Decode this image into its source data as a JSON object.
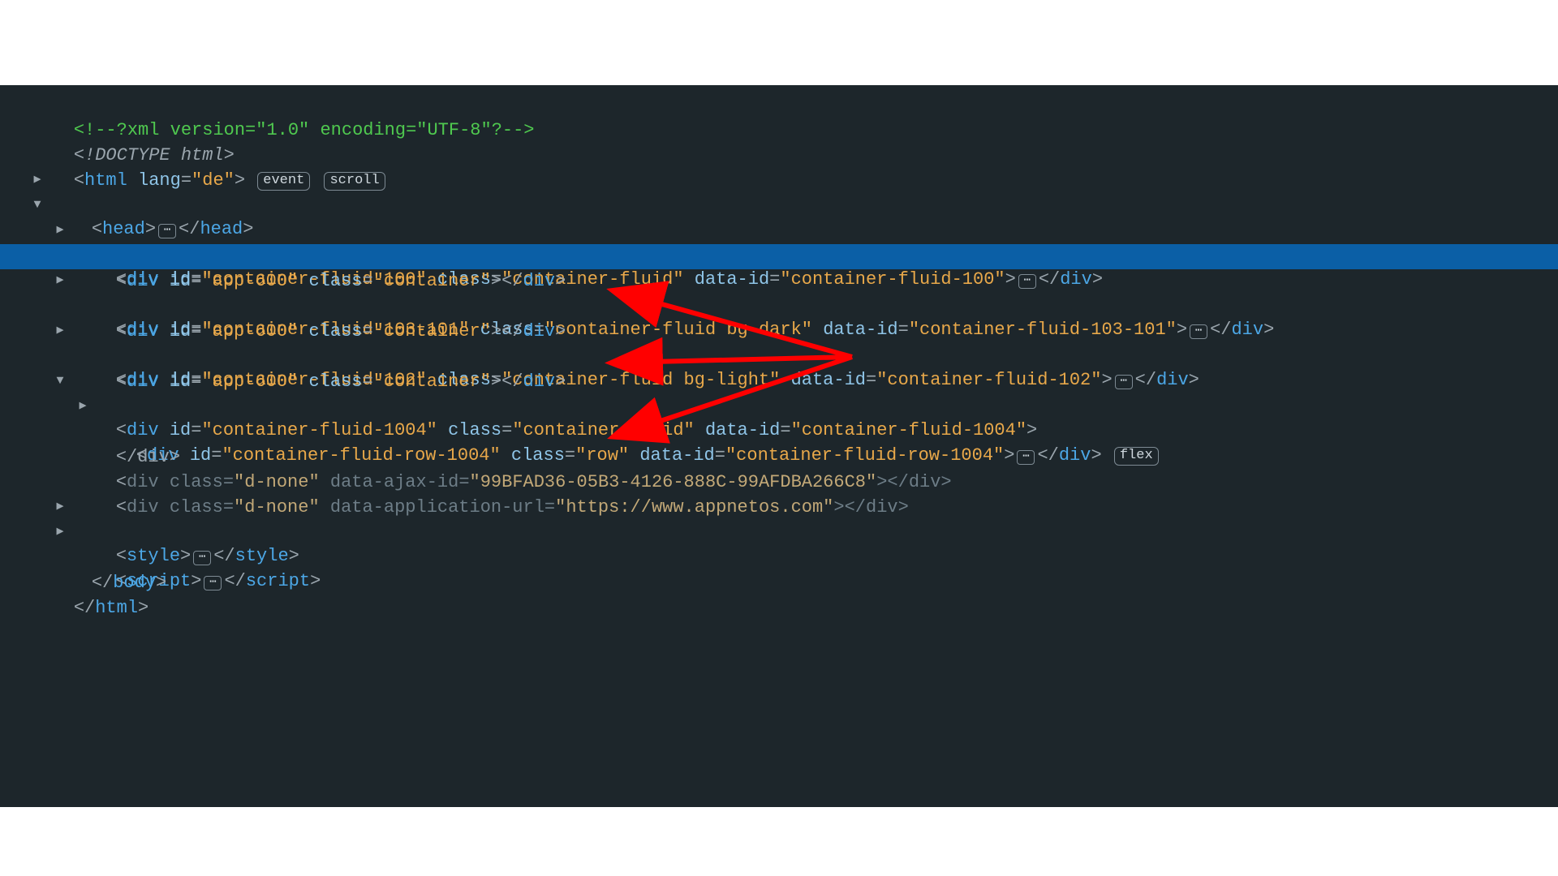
{
  "lines": {
    "xml": "<!--?xml version=\"1.0\" encoding=\"UTF-8\"?-->",
    "doctype": "<!DOCTYPE html>",
    "html_open_tag": "html",
    "html_lang_attr": "lang",
    "html_lang_val": "\"de\"",
    "badge_event": "event",
    "badge_scroll": "scroll",
    "head_tag": "head",
    "body_tag": "body",
    "div_tag": "div",
    "style_tag": "style",
    "script_tag": "script",
    "close_body": "</body>",
    "close_html": "</html>",
    "close_div": "</div>",
    "ellipsis": "⋯",
    "badge_flex": "flex"
  },
  "rows": {
    "r1": {
      "id_attr": "id",
      "id_val": "\"container-fluid-100\"",
      "class_attr": "class",
      "class_val": "\"container-fluid\"",
      "did_attr": "data-id",
      "did_val": "\"container-fluid-100\""
    },
    "r2": {
      "id_attr": "id",
      "id_val": "\"app-600\"",
      "class_attr": "class",
      "class_val": "\"container\""
    },
    "r3": {
      "id_attr": "id",
      "id_val": "\"container-fluid-103-101\"",
      "class_attr": "class",
      "class_val": "\"container-fluid bg-dark\"",
      "did_attr": "data-id",
      "did_val": "\"container-fluid-103-101\""
    },
    "r4": {
      "id_attr": "id",
      "id_val": "\"app-600\"",
      "class_attr": "class",
      "class_val": "\"container\""
    },
    "r5": {
      "id_attr": "id",
      "id_val": "\"container-fluid-102\"",
      "class_attr": "class",
      "class_val": "\"container-fluid bg-light\"",
      "did_attr": "data-id",
      "did_val": "\"container-fluid-102\""
    },
    "r6": {
      "id_attr": "id",
      "id_val": "\"app-600\"",
      "class_attr": "class",
      "class_val": "\"container\""
    },
    "r7": {
      "id_attr": "id",
      "id_val": "\"container-fluid-1004\"",
      "class_attr": "class",
      "class_val": "\"container-fluid\"",
      "did_attr": "data-id",
      "did_val": "\"container-fluid-1004\""
    },
    "r8": {
      "id_attr": "id",
      "id_val": "\"container-fluid-row-1004\"",
      "class_attr": "class",
      "class_val": "\"row\"",
      "did_attr": "data-id",
      "did_val": "\"container-fluid-row-1004\""
    },
    "r9": {
      "class_attr": "class",
      "class_val": "\"d-none\"",
      "ajax_attr": "data-ajax-id",
      "ajax_val": "\"99BFAD36-05B3-4126-888C-99AFDBA266C8\""
    },
    "r10": {
      "class_attr": "class",
      "class_val": "\"d-none\"",
      "url_attr": "data-application-url",
      "url_val": "\"https://www.appnetos.com\""
    }
  }
}
